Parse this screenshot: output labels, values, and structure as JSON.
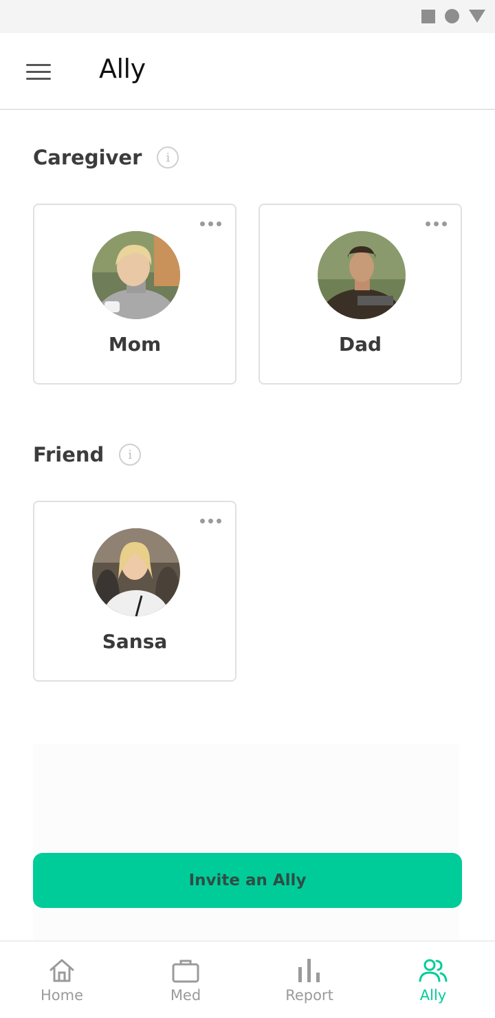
{
  "app": {
    "title": "Ally"
  },
  "sections": [
    {
      "title": "Caregiver",
      "members": [
        {
          "name": "Mom"
        },
        {
          "name": "Dad"
        }
      ]
    },
    {
      "title": "Friend",
      "members": [
        {
          "name": "Sansa"
        }
      ]
    }
  ],
  "actions": {
    "invite_label": "Invite an Ally"
  },
  "bottom_nav": {
    "items": [
      {
        "label": "Home",
        "icon": "home-icon"
      },
      {
        "label": "Med",
        "icon": "briefcase-icon"
      },
      {
        "label": "Report",
        "icon": "bar-chart-icon"
      },
      {
        "label": "Ally",
        "icon": "people-icon",
        "active": true
      }
    ]
  },
  "colors": {
    "accent": "#00cc99",
    "inactive": "#9a9a9a"
  }
}
